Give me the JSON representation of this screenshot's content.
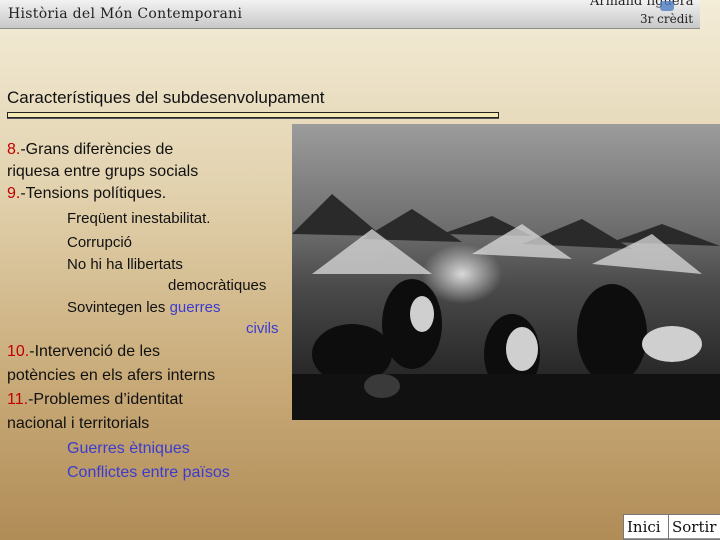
{
  "header": {
    "course": "Història del Món Contemporani",
    "author": "Armand figuera",
    "credit": "3r crèdit"
  },
  "slide": {
    "title": "Característiques del subdesenvolupament",
    "item8": {
      "num": "8.",
      "line1": "-Grans diferències de",
      "line2": "riquesa entre grups socials"
    },
    "item9": {
      "num": "9.",
      "text": "-Tensions polítiques."
    },
    "item9_points": {
      "p1": "Freqüent inestabilitat.",
      "p2": "Corrupció",
      "p3a": "No hi ha llibertats",
      "p3b": "democràtiques",
      "p4a": "Sovintegen les ",
      "p4b": "guerres",
      "p4c": "civils"
    },
    "item10": {
      "num": "10.",
      "line1": "-Intervenció de les",
      "line2": "potències en els afers interns"
    },
    "item11": {
      "num": "11.",
      "line1": "-Problemes d’identitat",
      "line2": "nacional i territorials"
    },
    "item11_points": {
      "p1": "Guerres ètniques",
      "p2": "Conflictes entre països"
    }
  },
  "nav": {
    "home": "Inici",
    "exit": "Sortir"
  },
  "colors": {
    "number": "#c00000",
    "highlight": "#3b3bd0"
  }
}
